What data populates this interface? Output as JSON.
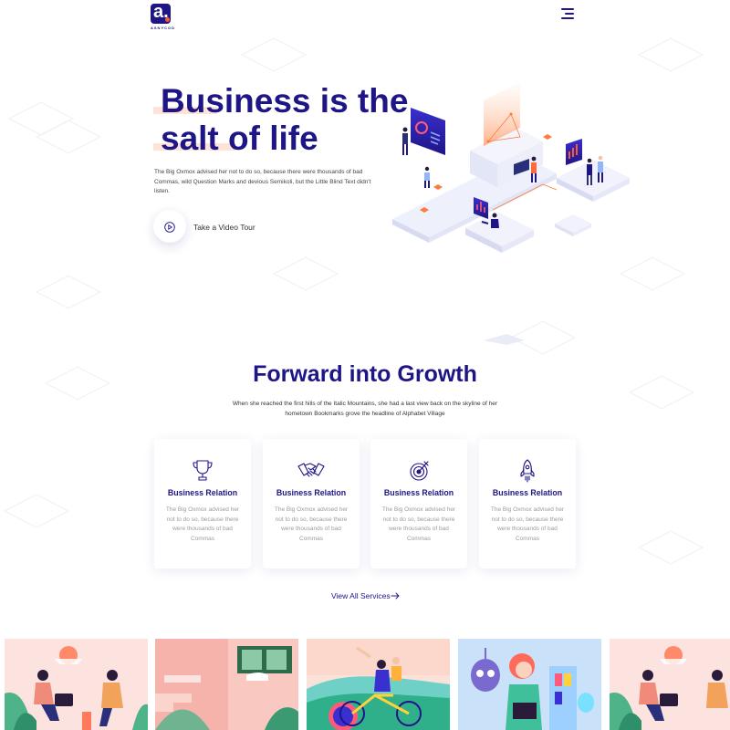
{
  "brand": {
    "logo_letter": "a.",
    "logo_name": "ASNYCOD",
    "primary_color": "#1e1586",
    "accent_color": "#ff5a2c"
  },
  "header": {
    "menu_icon": "hamburger-menu-icon"
  },
  "hero": {
    "title_line1": "Business is the",
    "title_line2": "salt of life",
    "description": "The Big Oxmox advised her not to do so, because there were thousands of bad Commas, wild Question Marks and devious Semikoli, but the Little Blind Text didn't listen.",
    "video_label": "Take a Video Tour",
    "video_icon": "play-icon",
    "illustration": "isometric-business-illustration"
  },
  "services": {
    "title": "Forward into Growth",
    "subtitle": "When she reached the first hills of the Italic Mountains, she had a last view back on the skyline of her hometown Bookmarks grove the headline of Alphabet Village",
    "cards": [
      {
        "icon": "trophy-icon",
        "title": "Business Relation",
        "text": "The Big Oxmox advised her not to do so, because there were thousands of bad Commas"
      },
      {
        "icon": "handshake-icon",
        "title": "Business Relation",
        "text": "The Big Oxmox advised her not to do so, because there were thousands of bad Commas"
      },
      {
        "icon": "target-icon",
        "title": "Business Relation",
        "text": "The Big Oxmox advised her not to do so, because there were thousands of bad Commas"
      },
      {
        "icon": "rocket-icon",
        "title": "Business Relation",
        "text": "The Big Oxmox advised her not to do so, because there were thousands of bad Commas"
      }
    ],
    "view_all_label": "View All Services",
    "view_all_icon": "arrow-right-icon"
  },
  "portfolio": {
    "items": [
      {
        "illustration": "couple-outdoors-illustration",
        "bg": "#fde3e0"
      },
      {
        "illustration": "pink-room-cat-illustration",
        "bg": "#f7b9b3"
      },
      {
        "illustration": "cycling-couple-illustration",
        "bg": "#fbe2d8"
      },
      {
        "illustration": "woman-with-robots-illustration",
        "bg": "#cde6fb"
      },
      {
        "illustration": "couple-outdoors-illustration",
        "bg": "#fde3e0"
      }
    ]
  }
}
